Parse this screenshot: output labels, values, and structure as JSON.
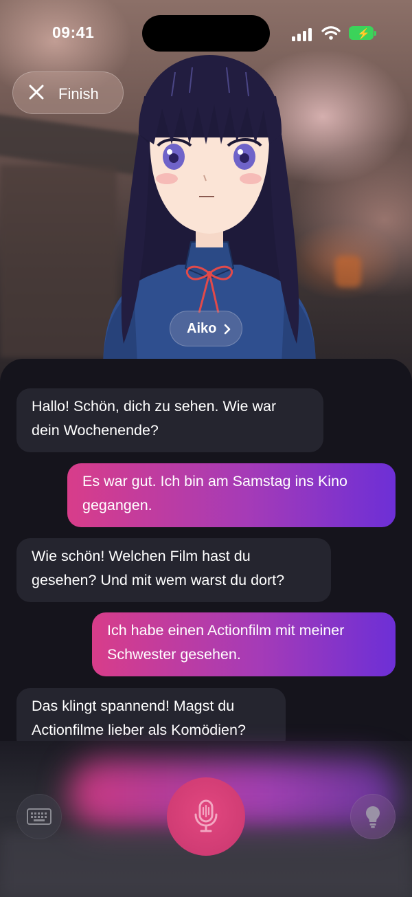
{
  "status_bar": {
    "time": "09:41"
  },
  "header": {
    "finish_label": "Finish"
  },
  "character": {
    "name": "Aiko"
  },
  "messages": [
    {
      "role": "ai",
      "text_lines": [
        "Hallo! Schön, dich zu sehen. Wie war",
        "dein Wochenende?"
      ]
    },
    {
      "role": "user",
      "text_lines": [
        "Es war gut. Ich bin am Samstag ins Kino",
        "gegangen."
      ]
    },
    {
      "role": "ai",
      "text_lines": [
        "Wie schön! Welchen Film hast du",
        "gesehen? Und mit wem warst du dort?"
      ]
    },
    {
      "role": "user",
      "text_lines": [
        "Ich habe einen Actionfilm mit meiner",
        "Schwester gesehen."
      ]
    },
    {
      "role": "ai",
      "text_lines": [
        "Das klingt spannend! Magst du",
        "Actionfilme lieber als Komödien?"
      ]
    }
  ],
  "controls": {
    "left_icon": "keyboard-icon",
    "center_icon": "microphone-icon",
    "right_icon": "lightbulb-icon"
  },
  "colors": {
    "user_bubble_gradient": [
      "#d83d8a",
      "#6d2fd6"
    ],
    "ai_bubble": "#25252f",
    "mic_button": "#d8407a",
    "battery": "#3bd35a"
  }
}
